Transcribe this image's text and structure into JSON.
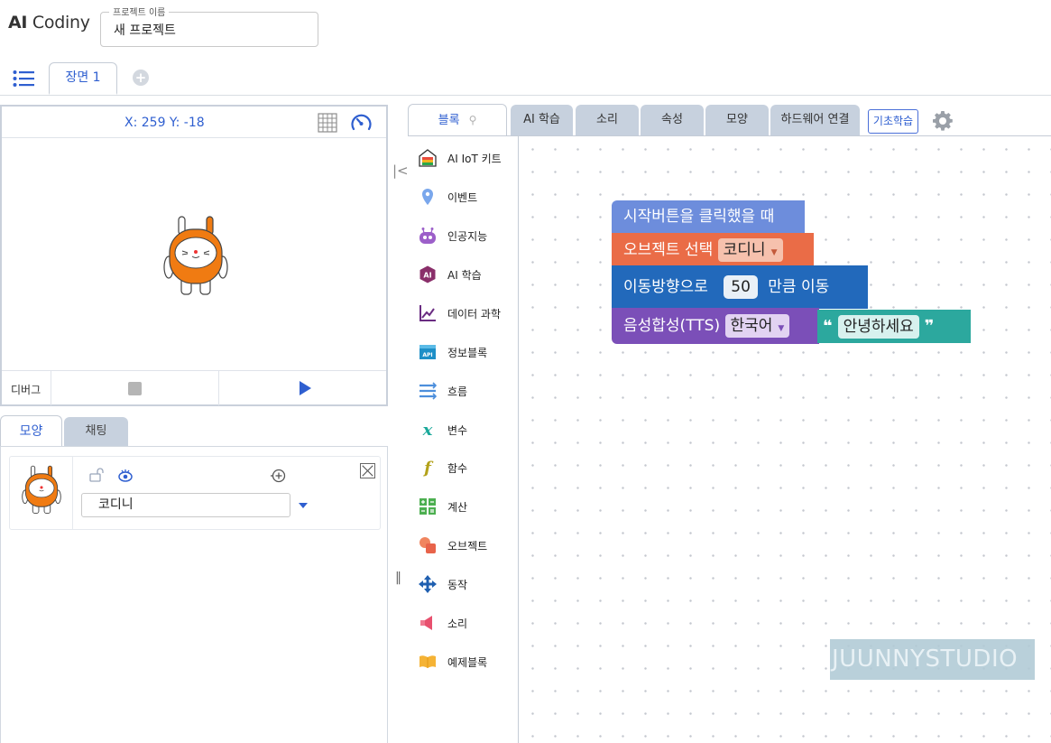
{
  "app": {
    "logo_bold": "AI",
    "logo_rest": " Codiny"
  },
  "project": {
    "legend": "프로젝트 이름",
    "name": "새 프로젝트"
  },
  "scene": {
    "tab_label": "장면 1",
    "add_label": "+"
  },
  "stage": {
    "coords": "X: 259 Y: -18",
    "debug_label": "디버그"
  },
  "object_panel": {
    "tabs": [
      "모양",
      "채팅"
    ],
    "object": {
      "name": "코디니"
    }
  },
  "block_tabs": {
    "tabs": [
      "블록",
      "AI 학습",
      "소리",
      "속성",
      "모양",
      "하드웨어 연결"
    ],
    "basic_label": "기초학습"
  },
  "categories": [
    {
      "label": "AI IoT 키트",
      "icon": "iot-kit-icon"
    },
    {
      "label": "이벤트",
      "icon": "event-pin-icon"
    },
    {
      "label": "인공지능",
      "icon": "robot-icon"
    },
    {
      "label": "AI 학습",
      "icon": "ai-learning-icon"
    },
    {
      "label": "데이터 과학",
      "icon": "chart-icon"
    },
    {
      "label": "정보블록",
      "icon": "api-icon"
    },
    {
      "label": "흐름",
      "icon": "flow-icon"
    },
    {
      "label": "변수",
      "icon": "variable-icon"
    },
    {
      "label": "함수",
      "icon": "function-icon"
    },
    {
      "label": "계산",
      "icon": "calculator-icon"
    },
    {
      "label": "오브젝트",
      "icon": "object-icon"
    },
    {
      "label": "동작",
      "icon": "move-arrows-icon"
    },
    {
      "label": "소리",
      "icon": "speaker-icon"
    },
    {
      "label": "예제블록",
      "icon": "book-icon"
    }
  ],
  "blocks": {
    "start": "시작버튼을 클릭했을 때",
    "select_label": "오브젝트 선택",
    "select_value": "코디니",
    "move_prefix": "이동방향으로",
    "move_value": "50",
    "move_suffix": "만큼 이동",
    "tts_label": "음성합성(TTS)",
    "tts_lang": "한국어",
    "tts_text": "안녕하세요"
  },
  "watermark": "JUUNNYSTUDIO",
  "colors": {
    "accent": "#2f5fd0",
    "event_block": "#6d8ddc",
    "object_block": "#ea6c47",
    "motion_block": "#2269bb",
    "tts_block": "#7b4fb8",
    "text_block": "#2ca89e",
    "character": "#f07b12"
  }
}
